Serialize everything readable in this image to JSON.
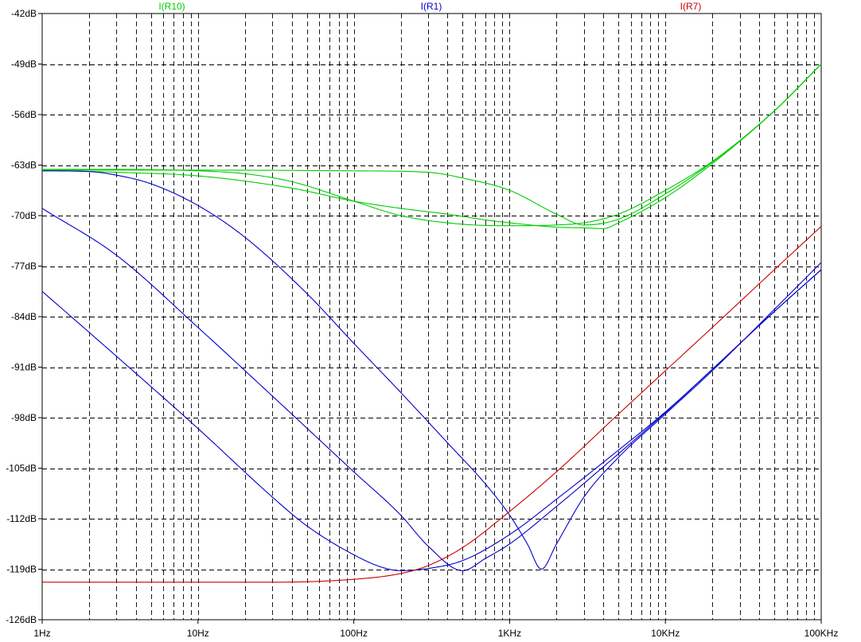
{
  "chart_data": {
    "type": "line",
    "x_scale": "log",
    "xlim": [
      "1Hz",
      "100KHz"
    ],
    "ylim_db": [
      -126,
      -42
    ],
    "grid": true,
    "y_ticks": [
      "-42dB",
      "-49dB",
      "-56dB",
      "-63dB",
      "-70dB",
      "-77dB",
      "-84dB",
      "-91dB",
      "-98dB",
      "-105dB",
      "-112dB",
      "-119dB",
      "-126dB"
    ],
    "x_ticks": [
      "1Hz",
      "10Hz",
      "100Hz",
      "1KHz",
      "10KHz",
      "100KHz"
    ],
    "legend": [
      {
        "name": "I(R10)",
        "color": "#00cc00"
      },
      {
        "name": "I(R1)",
        "color": "#0000cc"
      },
      {
        "name": "I(R7)",
        "color": "#cc0000"
      }
    ],
    "series": [
      {
        "name": "I(R10)",
        "color": "#00cc00",
        "x": [
          "1Hz",
          "3Hz",
          "10Hz",
          "20Hz",
          "40Hz",
          "100Hz",
          "200Hz",
          "500Hz",
          "1KHz",
          "2KHz",
          "3KHz",
          "5KHz",
          "10KHz",
          "20KHz",
          "50KHz",
          "100KHz"
        ],
        "y": [
          -63.6,
          -63.6,
          -63.8,
          -64.2,
          -65.3,
          -68,
          -70,
          -71.2,
          -71.4,
          -71.3,
          -71.0,
          -69.8,
          -66.5,
          -62.5,
          -55.5,
          -49
        ]
      },
      {
        "name": "I(R10)",
        "color": "#00cc00",
        "x": [
          "1Hz",
          "3Hz",
          "10Hz",
          "40Hz",
          "100Hz",
          "200Hz",
          "400Hz",
          "700Hz",
          "1KHz",
          "2KHz",
          "3KHz",
          "4KHz",
          "5KHz",
          "10KHz",
          "20KHz",
          "50KHz",
          "100KHz"
        ],
        "y": [
          -63.7,
          -64.0,
          -64.5,
          -66.2,
          -68.0,
          -69.0,
          -69.8,
          -70.6,
          -71.0,
          -71.6,
          -71.7,
          -71.8,
          -71.0,
          -67.5,
          -62.8,
          -55.5,
          -49
        ]
      },
      {
        "name": "I(R10)",
        "color": "#00cc00",
        "x": [
          "1Hz",
          "10Hz",
          "100Hz",
          "300Hz",
          "500Hz",
          "1KHz",
          "2KHz",
          "3KHz",
          "5KHz",
          "10KHz",
          "20KHz",
          "50KHz",
          "100KHz"
        ],
        "y": [
          -63.7,
          -63.7,
          -63.8,
          -64.0,
          -64.8,
          -66.5,
          -69.8,
          -71.3,
          -70.5,
          -67.0,
          -62.6,
          -55.5,
          -49
        ]
      },
      {
        "name": "I(R1)",
        "color": "#0000cc",
        "x": [
          "1Hz",
          "2Hz",
          "3Hz",
          "5Hz",
          "10Hz",
          "20Hz",
          "50Hz",
          "100Hz",
          "200Hz",
          "400Hz",
          "700Hz",
          "1KHz",
          "1.3KHz",
          "1.6KHz",
          "2KHz",
          "3KHz",
          "5KHz",
          "10KHz",
          "20KHz",
          "50KHz",
          "100KHz"
        ],
        "y": [
          -63.8,
          -63.9,
          -64.4,
          -65.6,
          -68.6,
          -73,
          -80.8,
          -87.7,
          -94.5,
          -101.5,
          -107.2,
          -111.5,
          -115.5,
          -119,
          -115.5,
          -109,
          -103.5,
          -97.5,
          -91.5,
          -83,
          -76.5
        ]
      },
      {
        "name": "I(R1)",
        "color": "#0000cc",
        "x": [
          "1Hz",
          "3Hz",
          "10Hz",
          "30Hz",
          "100Hz",
          "200Hz",
          "300Hz",
          "500Hz",
          "700Hz",
          "1KHz",
          "2KHz",
          "5KHz",
          "10KHz",
          "20KHz",
          "50KHz",
          "100KHz"
        ],
        "y": [
          -69,
          -75.5,
          -85.5,
          -95,
          -105.5,
          -111.5,
          -115.8,
          -119.2,
          -117.5,
          -115.5,
          -110.3,
          -103,
          -97.3,
          -91.3,
          -83.3,
          -77.5
        ]
      },
      {
        "name": "I(R1)",
        "color": "#0000cc",
        "x": [
          "1Hz",
          "3Hz",
          "10Hz",
          "30Hz",
          "50Hz",
          "100Hz",
          "150Hz",
          "200Hz",
          "300Hz",
          "500Hz",
          "1KHz",
          "2KHz",
          "5KHz",
          "10KHz",
          "20KHz",
          "50KHz",
          "100KHz"
        ],
        "y": [
          -80.5,
          -89.5,
          -99.5,
          -109,
          -113,
          -117,
          -118.7,
          -119.2,
          -118.9,
          -117.8,
          -114.2,
          -109.3,
          -102.5,
          -97.2,
          -91.3,
          -83.3,
          -77.5
        ]
      },
      {
        "name": "I(R7)",
        "color": "#cc0000",
        "x": [
          "1Hz",
          "10Hz",
          "30Hz",
          "100Hz",
          "200Hz",
          "300Hz",
          "500Hz",
          "1KHz",
          "2KHz",
          "5KHz",
          "10KHz",
          "20KHz",
          "50KHz",
          "100KHz"
        ],
        "y": [
          -120.8,
          -120.8,
          -120.8,
          -120.4,
          -119.6,
          -118.5,
          -116,
          -111,
          -105.5,
          -97.5,
          -91.5,
          -85.5,
          -77.5,
          -71.5
        ]
      }
    ]
  }
}
